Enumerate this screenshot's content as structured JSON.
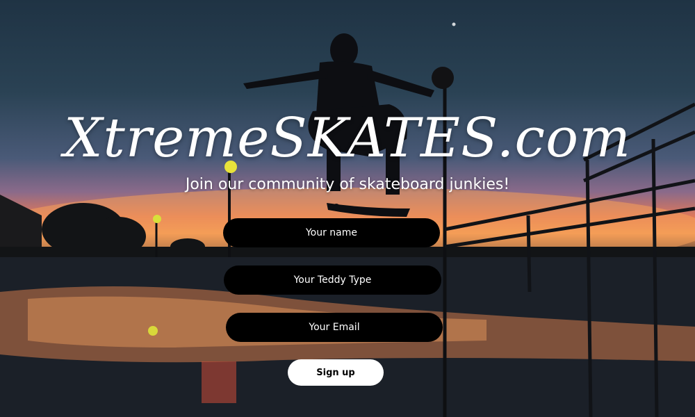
{
  "brand": {
    "title": "XtremeSKATES.com"
  },
  "tagline": "Join our community of skateboard junkies!",
  "form": {
    "name_placeholder": "Your name",
    "teddy_placeholder": "Your Teddy Type",
    "email_placeholder": "Your Email",
    "signup_label": "Sign up"
  },
  "colors": {
    "field_bg": "#000000",
    "field_text": "#ffffff",
    "button_bg": "#ffffff",
    "button_text": "#000000"
  }
}
